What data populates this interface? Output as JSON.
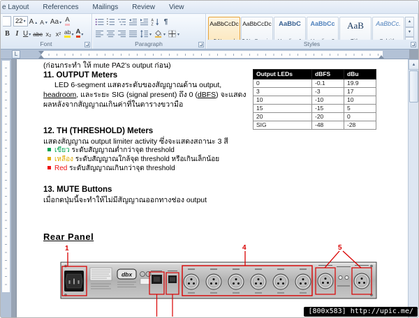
{
  "window": {
    "watermark": "[800x583] http://upic.me/"
  },
  "icons": {
    "caret_down": "▾",
    "scroll_up": "▲",
    "scroll_down": "▼",
    "pilcrow": "¶",
    "ruler_tab": "L"
  },
  "ribbon": {
    "tabs": [
      "e Layout",
      "References",
      "Mailings",
      "Review",
      "View"
    ],
    "font": {
      "size_value": "22",
      "grow": "A",
      "shrink": "A",
      "change_case": "Aa",
      "clear": "A",
      "bold": "B",
      "italic": "I",
      "underline": "U",
      "strike": "abc",
      "subscript": "x₂",
      "superscript": "x²",
      "highlight": "ab",
      "font_color": "A"
    },
    "groups": {
      "font": "Font",
      "paragraph": "Paragraph",
      "styles": "Styles"
    },
    "styles": [
      {
        "preview": "AaBbCcDc",
        "label": "¶ Normal"
      },
      {
        "preview": "AaBbCcDc",
        "label": "¶ No Spaci..."
      },
      {
        "preview": "AaBbC",
        "label": "Heading 1"
      },
      {
        "preview": "AaBbCc",
        "label": "Heading 2"
      },
      {
        "preview": "AaB",
        "label": "Title"
      },
      {
        "preview": "AaBbCc.",
        "label": "Subtitle"
      }
    ]
  },
  "document": {
    "intro": "(ก่อนกระทำ ให้ mute PA2's output ก่อน)",
    "s11": {
      "heading": "11. OUTPUT Meters",
      "p": [
        "LED 6-segment แสดงระดับของสัญญาณด้าน output, ",
        "headroom",
        ", และระยะ SIG (signal present) ถึง 0 (",
        "dBFS",
        ") จะแสดงผลหลังจากสัญญาณเกินค่าที่ในตารางขวามือ"
      ]
    },
    "table": {
      "headers": [
        "Output LEDs",
        "dBFS",
        "dBu"
      ],
      "rows": [
        [
          "0",
          "-0.1",
          "19.9"
        ],
        [
          "3",
          "-3",
          "17"
        ],
        [
          "10",
          "-10",
          "10"
        ],
        [
          "15",
          "-15",
          "5"
        ],
        [
          "20",
          "-20",
          "0"
        ],
        [
          "SIG",
          "-48",
          "-28"
        ]
      ]
    },
    "s12": {
      "heading": "12. TH (THRESHOLD) Meters",
      "p": "แสดงสัญญาณ output limiter activity ซึ่งจะแสดงสถานะ 3 สี",
      "bullets": [
        {
          "word": "เขียว",
          "text": "ระดับสัญญาณต่ำกว่าจุด threshold",
          "color": "#00a550"
        },
        {
          "word": "เหลือง",
          "text": "ระดับสัญญาณใกล้จุด threshold หรือเกินเล็กน้อย",
          "color": "#e0ab00"
        },
        {
          "word": "Red",
          "text": "ระดับสัญญาณเกินกว่าจุด threshold",
          "color": "#ee1111"
        }
      ]
    },
    "s13": {
      "heading": "13. MUTE Buttons",
      "p": "เมื่อกดปุ่มนี้จะทำให้ไม่มีสัญญาณออกทางช่อง output"
    },
    "rear": {
      "heading": "Rear Panel",
      "logo": "dbx",
      "n1": "1",
      "n4": "4",
      "n5": "5",
      "annotation_color": "#d90000"
    }
  }
}
